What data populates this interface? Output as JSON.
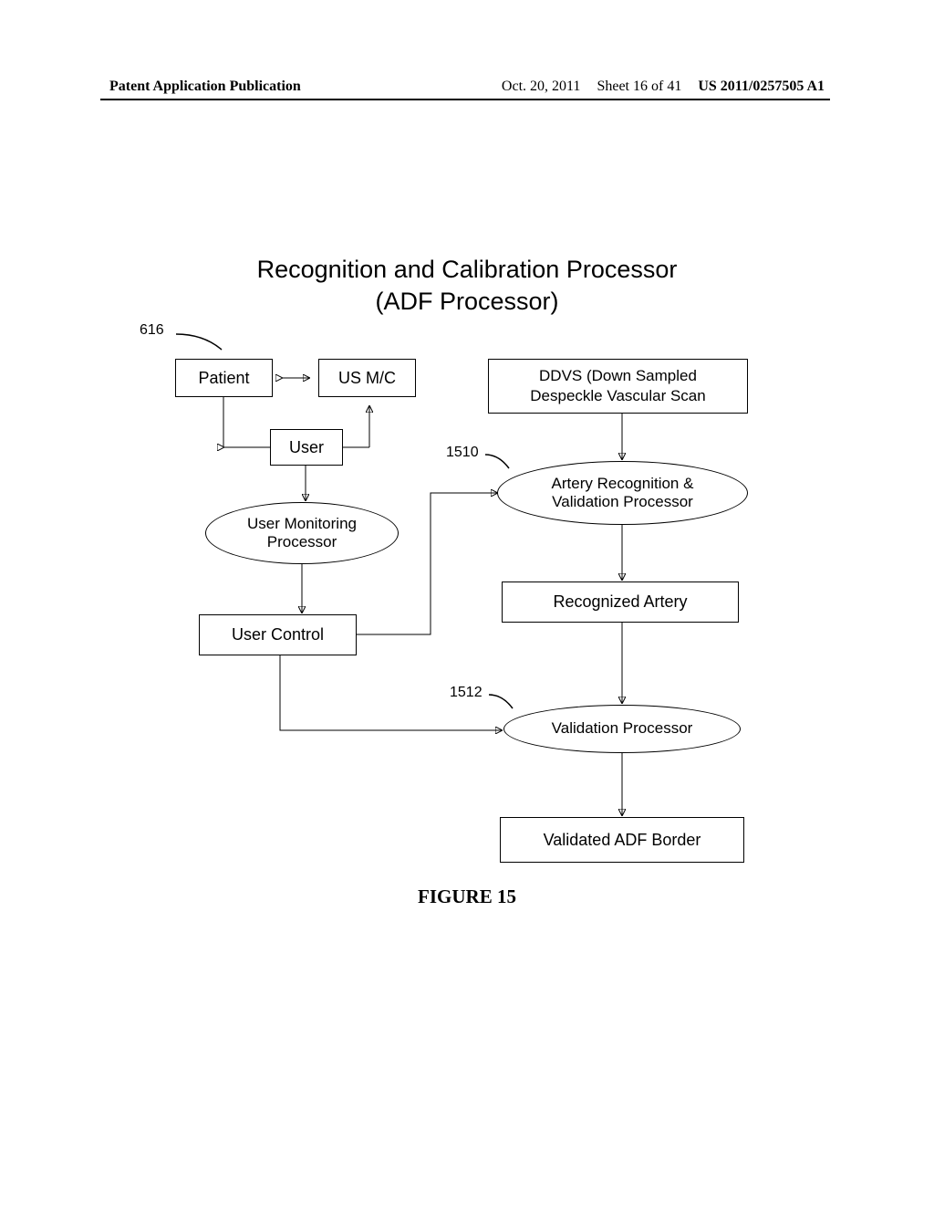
{
  "header": {
    "left": "Patent Application Publication",
    "date": "Oct. 20, 2011",
    "sheet": "Sheet 16 of 41",
    "pubnum": "US 2011/0257505 A1"
  },
  "title": {
    "line1": "Recognition and Calibration Processor",
    "line2": "(ADF Processor)"
  },
  "refs": {
    "r616": "616",
    "r1510": "1510",
    "r1512": "1512"
  },
  "nodes": {
    "patient": "Patient",
    "usmc": "US M/C",
    "ddvs_line1": "DDVS (Down Sampled",
    "ddvs_line2": "Despeckle Vascular Scan",
    "user": "User",
    "artery_line1": "Artery Recognition &",
    "artery_line2": "Validation Processor",
    "monitoring_line1": "User Monitoring",
    "monitoring_line2": "Processor",
    "recognized": "Recognized Artery",
    "usercontrol": "User Control",
    "validation": "Validation Processor",
    "validated": "Validated ADF Border"
  },
  "caption": "FIGURE 15"
}
